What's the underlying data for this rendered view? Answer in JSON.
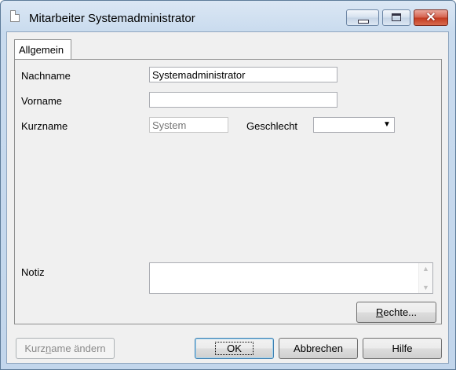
{
  "window": {
    "title": "Mitarbeiter Systemadministrator",
    "controls": {
      "minimize": "minimize",
      "maximize": "maximize",
      "close": "✕"
    }
  },
  "tabs": [
    {
      "label": "Allgemein",
      "active": true
    }
  ],
  "form": {
    "nachname": {
      "label": "Nachname",
      "value": "Systemadministrator"
    },
    "vorname": {
      "label": "Vorname",
      "value": ""
    },
    "kurzname": {
      "label": "Kurzname",
      "placeholder": "System"
    },
    "geschlecht": {
      "label": "Geschlecht",
      "value": ""
    },
    "notiz": {
      "label": "Notiz",
      "value": ""
    }
  },
  "buttons": {
    "rechte": {
      "pre": "",
      "mnemonic": "R",
      "post": "echte..."
    },
    "kurzname_aendern": {
      "pre": "Kurz",
      "mnemonic": "n",
      "post": "ame ändern"
    },
    "ok": "OK",
    "abbrechen": "Abbrechen",
    "hilfe": "Hilfe"
  }
}
